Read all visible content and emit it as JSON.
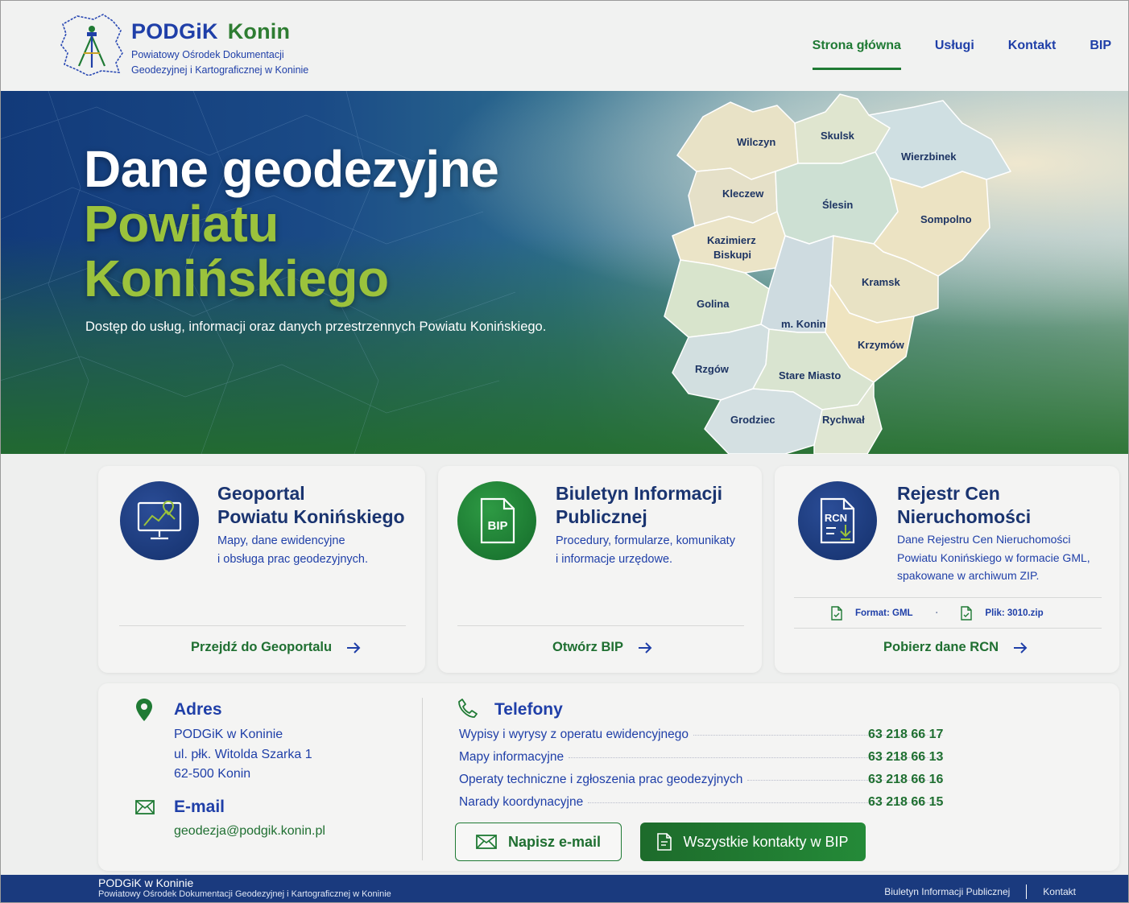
{
  "header": {
    "brand_name": "PODGiK",
    "brand_city": "Konin",
    "brand_sub_line1": "Powiatowy Ośrodek Dokumentacji",
    "brand_sub_line2": "Geodezyjnej i Kartograficznej w Koninie",
    "nav": [
      {
        "label": "Strona główna",
        "active": true
      },
      {
        "label": "Usługi"
      },
      {
        "label": "Kontakt"
      },
      {
        "label": "BIP"
      }
    ]
  },
  "hero": {
    "title_line1": "Dane geodezyjne",
    "title_line2": "Powiatu",
    "title_line3": "Konińskiego",
    "subtitle": "Dostęp do usług, informacji oraz danych przestrzennych Powiatu Konińskiego.",
    "map_regions": [
      "Wilczyn",
      "Skulsk",
      "Wierzbinek",
      "Kleczew",
      "Ślesin",
      "Sompolno",
      "Kazimierz",
      "Biskupi",
      "Golina",
      "m. Konin",
      "Kramsk",
      "Krzymów",
      "Rzgów",
      "Stare Miasto",
      "Grodziec",
      "Rychwał"
    ]
  },
  "cards": [
    {
      "title_line1": "Geoportal",
      "title_line2": "Powiatu Konińskiego",
      "desc_line1": "Mapy, dane ewidencyjne",
      "desc_line2": "i obsługa prac geodezyjnych.",
      "link": "Przejdź do Geoportalu",
      "icon": "monitor-map-icon"
    },
    {
      "title_line1": "Biuletyn Informacji",
      "title_line2": "Publicznej",
      "desc_line1": "Procedury, formularze, komunikaty",
      "desc_line2": "i informacje urzędowe.",
      "link": "Otwórz BIP",
      "icon_text": "BIP"
    },
    {
      "title_line1": "Rejestr Cen",
      "title_line2": "Nieruchomości",
      "desc_line1": "Dane Rejestru Cen Nieruchomości",
      "desc_line2": "Powiatu Konińskiego w formacie GML,",
      "desc_line3": "spakowane w archiwum ZIP.",
      "meta_format": "Format: GML",
      "meta_sep": "·",
      "meta_file": "Plik: 3010.zip",
      "link": "Pobierz dane RCN",
      "icon_text": "RCN"
    }
  ],
  "contact": {
    "address_head": "Adres",
    "address_lines": [
      "PODGiK w Koninie",
      "ul. płk. Witolda Szarka 1",
      "62-500 Konin"
    ],
    "email_head": "E-mail",
    "email": "geodezja@podgik.konin.pl",
    "phones_head": "Telefony",
    "phones": [
      {
        "label": "Wypisy i wyrysy z operatu ewidencyjnego",
        "number": "63 218 66 17"
      },
      {
        "label": "Mapy informacyjne",
        "number": "63 218 66 13"
      },
      {
        "label": "Operaty techniczne i zgłoszenia prac geodezyjnych",
        "number": "63 218 66 16"
      },
      {
        "label": "Narady koordynacyjne",
        "number": "63 218 66 15"
      }
    ],
    "btn_email": "Napisz e-mail",
    "btn_bip": "Wszystkie kontakty w BIP"
  },
  "footer": {
    "title": "PODGiK w Koninie",
    "sub": "Powiatowy Ośrodek Dokumentacji Geodezyjnej i Kartograficznej w Koninie",
    "links": [
      "Biuletyn Informacji Publicznej",
      "Kontakt"
    ]
  },
  "colors": {
    "primary_blue": "#1f3fa8",
    "primary_green": "#1f7a34",
    "footer_bg": "#1a3a7e"
  }
}
